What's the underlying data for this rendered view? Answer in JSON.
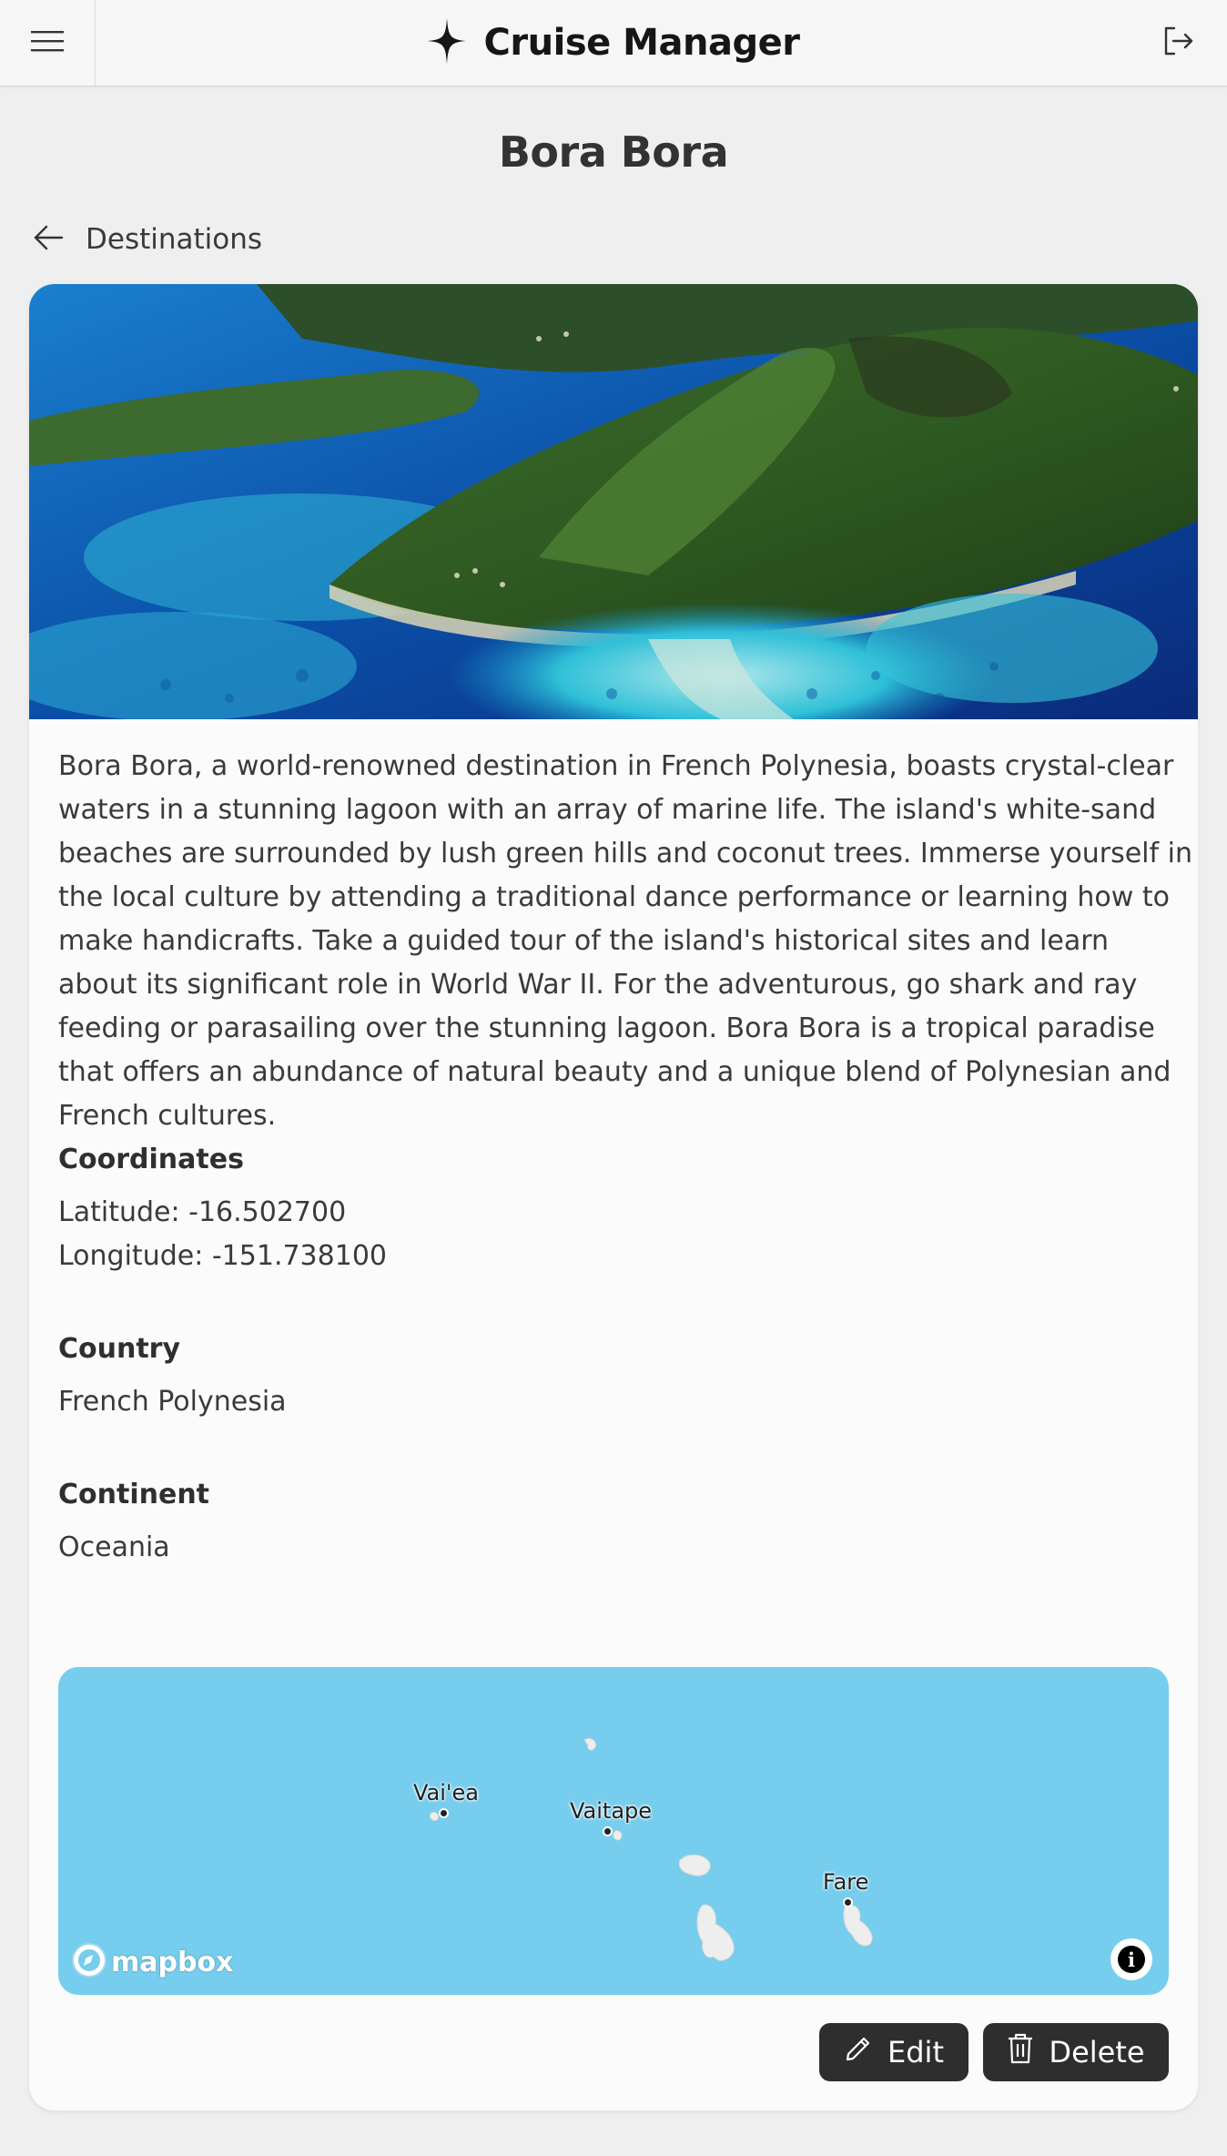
{
  "header": {
    "app_title": "Cruise Manager",
    "menu_icon": "hamburger-menu-icon",
    "logout_icon": "logout-icon",
    "logo_icon": "sparkle-star-icon"
  },
  "page": {
    "title": "Bora Bora",
    "back_label": "Destinations"
  },
  "destination": {
    "description": "Bora Bora, a world-renowned destination in French Polynesia, boasts crystal-clear waters in a stunning lagoon with an array of marine life. The island's white-sand beaches are surrounded by lush green hills and coconut trees. Immerse yourself in the local culture by attending a traditional dance performance or learning how to make handicrafts. Take a guided tour of the island's historical sites and learn about its significant role in World War II. For the adventurous, go shark and ray feeding or parasailing over the stunning lagoon. Bora Bora is a tropical paradise that offers an abundance of natural beauty and a unique blend of Polynesian and French cultures.",
    "coordinates_heading": "Coordinates",
    "latitude": "Latitude: -16.502700",
    "longitude": "Longitude: -151.738100",
    "country_heading": "Country",
    "country": "French Polynesia",
    "continent_heading": "Continent",
    "continent": "Oceania"
  },
  "map": {
    "places": [
      "Vai'ea",
      "Vaitape",
      "Fare"
    ],
    "attribution_logo": "mapbox",
    "info_icon": "info-icon",
    "water_color": "#76cded"
  },
  "actions": {
    "edit_label": "Edit",
    "delete_label": "Delete",
    "edit_icon": "pencil-icon",
    "delete_icon": "trash-icon"
  }
}
